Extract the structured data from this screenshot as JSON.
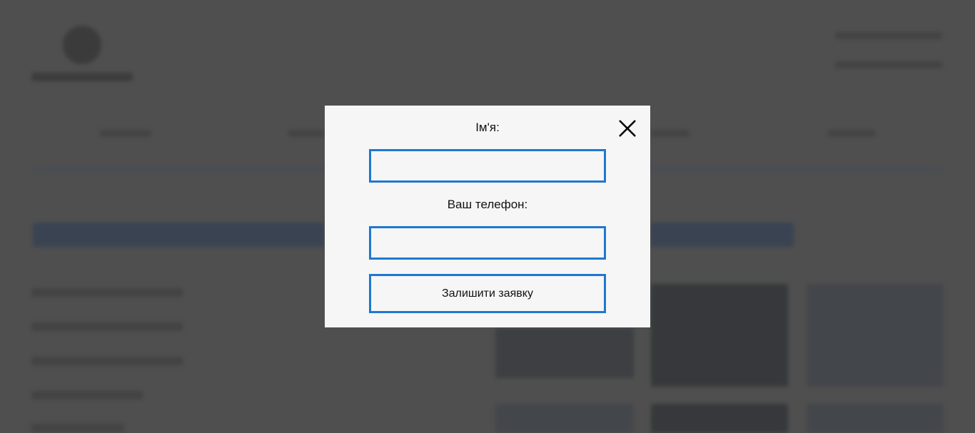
{
  "modal": {
    "name_label": "Ім'я:",
    "name_value": "",
    "phone_label": "Ваш телефон:",
    "phone_value": "",
    "submit_label": "Залишити заявку",
    "close_icon": "close-icon"
  },
  "colors": {
    "accent": "#1f78cf",
    "modal_bg": "#f6f6f6",
    "overlay": "#4f4f4f"
  }
}
